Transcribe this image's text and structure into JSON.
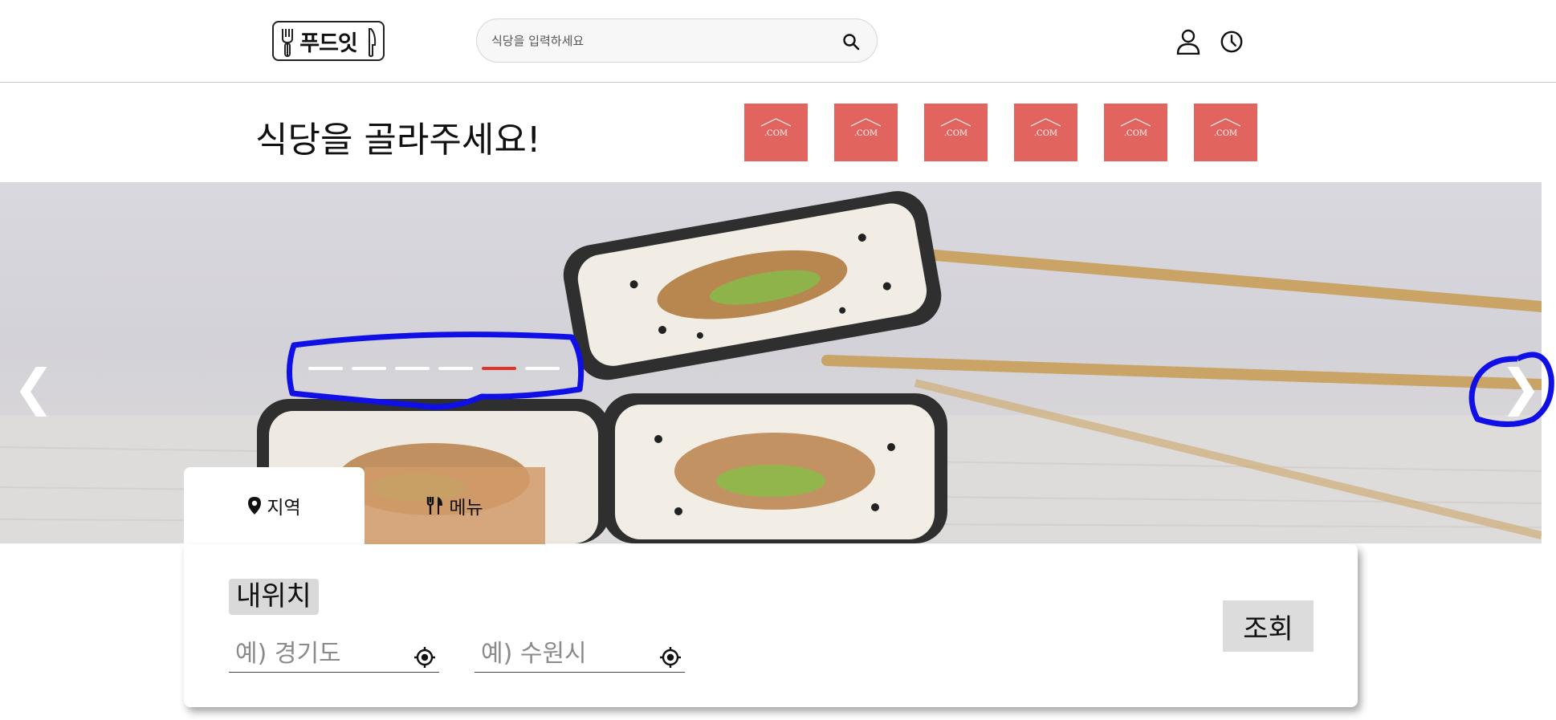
{
  "header": {
    "logo_text": "푸드잇",
    "search_placeholder": "식당을 입력하세요"
  },
  "title_row": {
    "title": "식당을 골라주세요!",
    "thumbnails": [
      ".COM",
      ".COM",
      ".COM",
      ".COM",
      ".COM",
      ".COM"
    ]
  },
  "carousel": {
    "prev_label": "❮",
    "next_label": "❯",
    "indicator_count": 6,
    "active_index": 4
  },
  "tabs": {
    "region_label": "지역",
    "menu_label": "메뉴"
  },
  "search_panel": {
    "my_location_label": "내위치",
    "province_placeholder": "예) 경기도",
    "city_placeholder": "예) 수원시",
    "query_button": "조회"
  },
  "colors": {
    "thumb_bg": "#e1645f",
    "active_indicator": "#e0332b",
    "menu_tab_bg": "#d19b6a",
    "annotation": "#1010e6"
  }
}
